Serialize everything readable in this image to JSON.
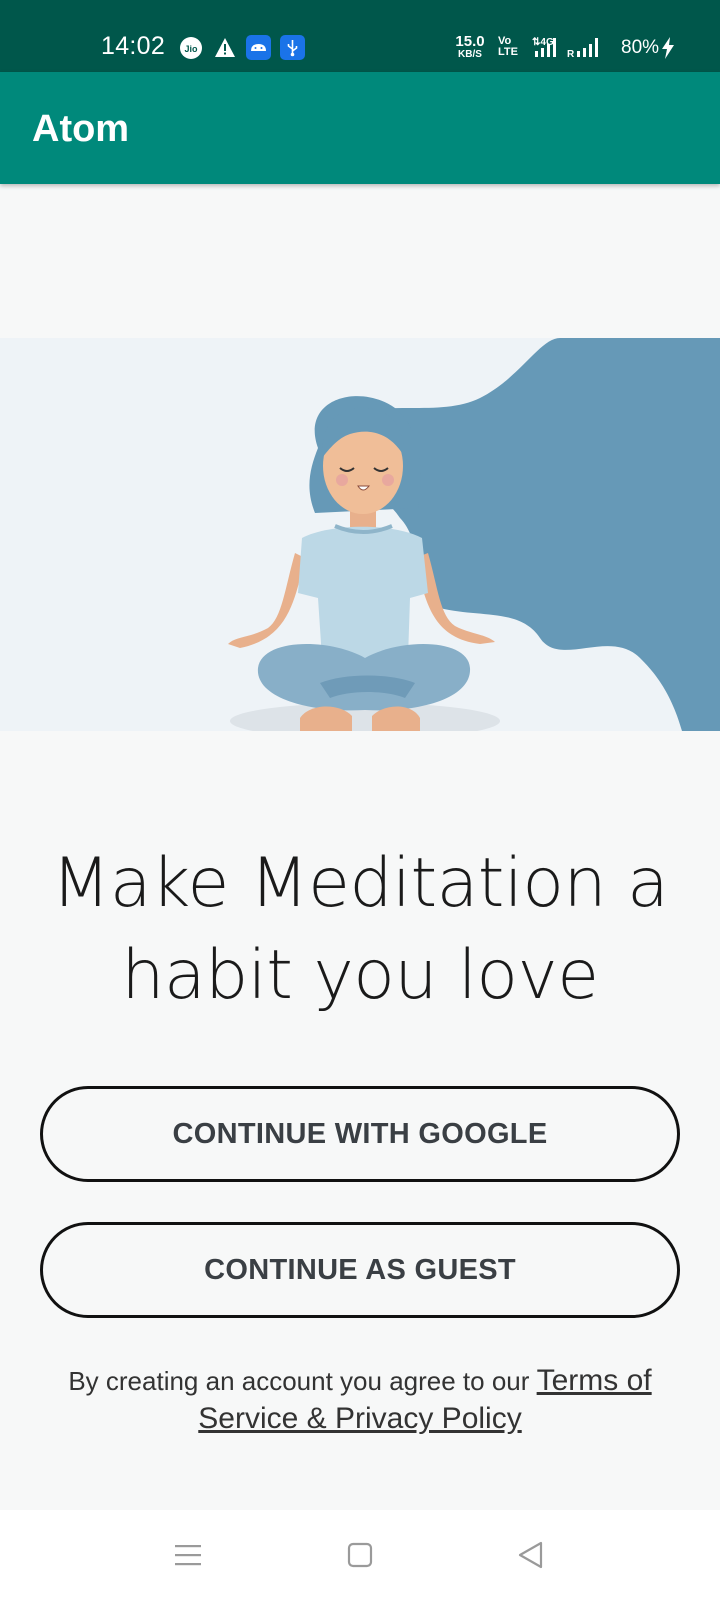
{
  "status_bar": {
    "time": "14:02",
    "carrier_icon": "Jio",
    "net_speed_value": "15.0",
    "net_speed_unit": "KB/S",
    "volte_top": "Vo",
    "volte_bottom": "LTE",
    "network_type": "4G",
    "roaming": "R",
    "battery": "80%",
    "icons": [
      "jio-icon",
      "alert-icon",
      "android-icon",
      "usb-icon",
      "signal-icon",
      "charging-icon"
    ]
  },
  "app_bar": {
    "title": "Atom"
  },
  "hero": {
    "illustration": "woman-meditating-illustration"
  },
  "headline": {
    "line1": "Make Meditation a",
    "line2": "habit you love"
  },
  "buttons": {
    "google_label": "CONTINUE WITH GOOGLE",
    "guest_label": "CONTINUE AS GUEST"
  },
  "terms": {
    "prefix": "By creating an account you agree to our ",
    "link": "Terms of Service & Privacy Policy"
  },
  "nav_bar": {
    "icons": [
      "menu-icon",
      "home-icon",
      "back-icon"
    ]
  },
  "colors": {
    "status_bar": "#00574b",
    "app_bar": "#00897b",
    "background": "#f7f8f8",
    "hair": "#6699b7",
    "illustration_bg": "#eef3f7"
  }
}
